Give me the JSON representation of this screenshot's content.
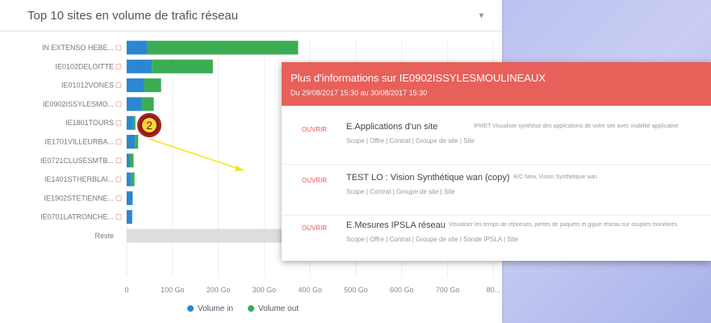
{
  "card": {
    "title": "Top 10 sites en volume de trafic réseau",
    "caret_icon": "caret-down"
  },
  "chart_data": {
    "type": "bar",
    "orientation": "horizontal",
    "stacked": true,
    "categories": [
      "IN EXTENSO HEBE...",
      "IE0102DELOITTE",
      "IE01012VONES",
      "IE0902ISSYLESMO...",
      "IE1801TOURS",
      "IE1701VILLEURBA...",
      "IE0721CLUSESMTB...",
      "IE1401STHERBLAI...",
      "IE1902STETIENNE...",
      "IE0701LATRONCHE...",
      "Reste"
    ],
    "series": [
      {
        "name": "Volume in",
        "color": "#2b87d1",
        "values": [
          44,
          55,
          38,
          34,
          14,
          18,
          7,
          10,
          13,
          12,
          0
        ]
      },
      {
        "name": "Volume out",
        "color": "#3cac54",
        "values": [
          330,
          133,
          37,
          25,
          5,
          7,
          8,
          7,
          0,
          0,
          0
        ]
      }
    ],
    "reste_value": 555,
    "reste_color": "#dddddd",
    "x_ticks": [
      "0",
      "100 Go",
      "200 Go",
      "300 Go",
      "400 Go",
      "500 Go",
      "600 Go",
      "700 Go",
      "80..."
    ],
    "xlim": [
      0,
      800
    ],
    "legend": [
      "Volume in",
      "Volume out"
    ],
    "legend_position": "bottom"
  },
  "popup": {
    "title": "Plus d'informations sur IE0902ISSYLESMOULINEAUX",
    "subtitle": "Du 29/08/2017 15:30 au 30/08/2017 15:30",
    "rows": [
      {
        "badge": "OUVRIR",
        "name": "E.Applications d'un site",
        "desc": "IPMET Visualiser synthèse des applications de votre site avec visibilité applicative",
        "links": "Scope | Offre | Contrat | Groupe de site | Site"
      },
      {
        "badge": "OUVRIR",
        "name": "TEST LO : Vision Synthétique wan (copy)",
        "desc": "R/C New, Vision Synthetique wan",
        "links": "Scope | Contrat | Groupe de site | Site"
      },
      {
        "badge": "OUVRIR",
        "name": "E.Mesures IPSLA réseau",
        "desc": "Visualiser les temps de réponses, pertes de paquets et gigue réseau sur couples monitorés",
        "links": "Scope | Offre | Contrat | Groupe de site | Sonde IPSLA | Site"
      }
    ]
  },
  "callout": {
    "label": "2",
    "color": "#8b1a1a",
    "fill": "#f2d63a"
  },
  "arrow": {
    "color": "#f0e81a"
  }
}
